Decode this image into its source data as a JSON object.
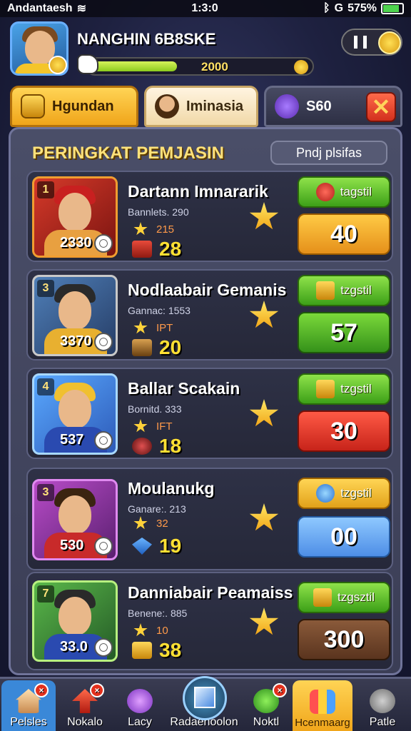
{
  "status_bar": {
    "carrier": "Andantaesh",
    "time": "1:3:0",
    "network": "G",
    "battery": "575%"
  },
  "header": {
    "player_name": "NANGHIN 6B8SKE",
    "xp_value": "2000",
    "xp_progress": 0.38
  },
  "tabs": [
    {
      "label": "Hgundan",
      "icon": "chest-icon",
      "active": true
    },
    {
      "label": "Iminasia",
      "icon": "hero-icon",
      "active": false
    },
    {
      "label": "S60",
      "icon": "potion-icon",
      "active": false
    }
  ],
  "panel": {
    "title": "PERINGKAT PEMJASIN",
    "filter_label": "Pndj plsifas"
  },
  "rows": [
    {
      "rank": "1",
      "name": "Dartann Imnararik",
      "sub": "Bannlets. 290",
      "power": "2330",
      "stat_small": "215",
      "stat_big": "28",
      "tag": "tagstil",
      "score": "40",
      "color": "red"
    },
    {
      "rank": "3",
      "name": "Nodlaabair Gemanis",
      "sub": "Gannac: 1553",
      "power": "3370",
      "stat_small": "IPT",
      "stat_big": "20",
      "tag": "tzgstil",
      "score": "57",
      "color": "gold"
    },
    {
      "rank": "4",
      "name": "Ballar Scakain",
      "sub": "Bornitd. 333",
      "power": "537",
      "stat_small": "IFT",
      "stat_big": "18",
      "tag": "tzgstil",
      "score": "30",
      "color": "blue"
    },
    {
      "rank": "3",
      "name": "Moulanukg",
      "sub": "Ganare:. 213",
      "power": "530",
      "stat_small": "32",
      "stat_big": "19",
      "tag": "tzgstil",
      "score": "00",
      "color": "purple"
    },
    {
      "rank": "7",
      "name": "Danniabair Peamaiss",
      "sub": "Benene:. 885",
      "power": "33.0",
      "stat_small": "10",
      "stat_big": "38",
      "tag": "tzgsztil",
      "score": "300",
      "color": "green"
    }
  ],
  "bottom_nav": [
    {
      "label": "Pelsles",
      "icon": "home-icon"
    },
    {
      "label": "Nokalo",
      "icon": "arrow-up-icon"
    },
    {
      "label": "Lacy",
      "icon": "flower-icon"
    },
    {
      "label": "Radaenoolon",
      "icon": "cube-icon"
    },
    {
      "label": "Noktl",
      "icon": "gear-icon"
    },
    {
      "label": "Hcenmaarg",
      "icon": "gift-icon"
    },
    {
      "label": "Patle",
      "icon": "cog-icon"
    }
  ]
}
